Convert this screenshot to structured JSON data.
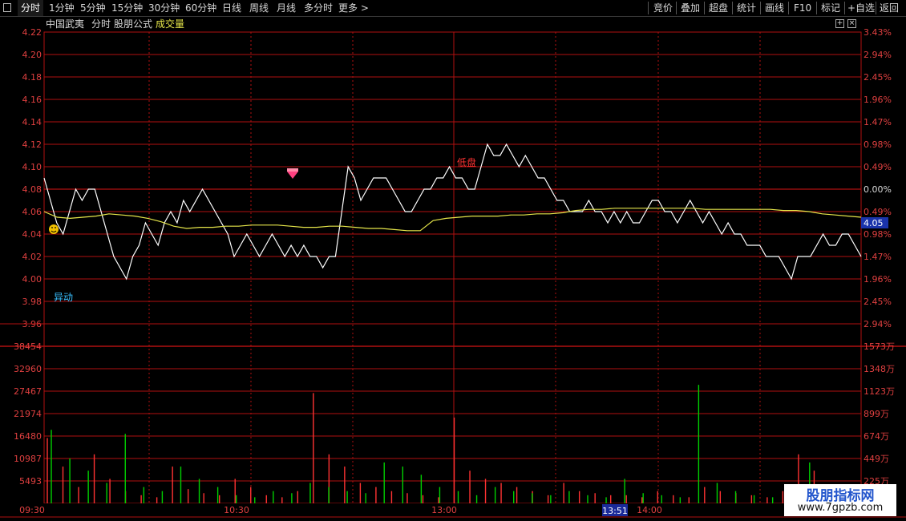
{
  "toolbar": {
    "periods": [
      "分时",
      "1分钟",
      "5分钟",
      "15分钟",
      "30分钟",
      "60分钟",
      "日线",
      "周线",
      "月线",
      "多分时"
    ],
    "more": "更多",
    "right_buttons": [
      "竞价",
      "叠加",
      "超盘",
      "统计",
      "画线",
      "F10",
      "标记",
      "+自选",
      "返回"
    ]
  },
  "subbar": {
    "stock_name": "中国武夷",
    "mode": "分时",
    "formula": "股朋公式",
    "volume_label": "成交量"
  },
  "price_axis": {
    "left_labels": [
      "4.22",
      "4.20",
      "4.18",
      "4.16",
      "4.14",
      "4.12",
      "4.10",
      "4.08",
      "4.06",
      "4.04",
      "4.02",
      "4.00",
      "3.98",
      "3.96"
    ],
    "right_labels": [
      "3.43%",
      "2.94%",
      "2.45%",
      "1.96%",
      "1.47%",
      "0.98%",
      "0.49%",
      "0.00%",
      "0.49%",
      "0.98%",
      "1.47%",
      "1.96%",
      "2.45%",
      "2.94%"
    ],
    "current_price": "4.05",
    "ylim": [
      3.96,
      4.22
    ]
  },
  "volume_axis": {
    "left_labels": [
      "38454",
      "32960",
      "27467",
      "21974",
      "16480",
      "10987",
      "5493"
    ],
    "right_labels": [
      "1573万",
      "1348万",
      "1123万",
      "899万",
      "674万",
      "449万",
      "225万"
    ]
  },
  "time_axis": {
    "labels": [
      "09:30",
      "10:30",
      "13:00",
      "14:00"
    ],
    "cursor_time": "13:51"
  },
  "annotations": {
    "yidong": "异动",
    "dipan": "低盘"
  },
  "colors": {
    "up": "#ff3232",
    "down": "#00d000",
    "grid": "#b01010",
    "price_line": "#ffffff",
    "avg_line": "#e6e64a",
    "text_left": "#e04040",
    "text_cyan": "#38c0ff"
  },
  "chart_data": {
    "type": "line",
    "price": [
      4.09,
      4.07,
      4.05,
      4.04,
      4.06,
      4.08,
      4.07,
      4.08,
      4.08,
      4.06,
      4.04,
      4.02,
      4.01,
      4.0,
      4.02,
      4.03,
      4.05,
      4.04,
      4.03,
      4.05,
      4.06,
      4.05,
      4.07,
      4.06,
      4.07,
      4.08,
      4.07,
      4.06,
      4.05,
      4.04,
      4.02,
      4.03,
      4.04,
      4.03,
      4.02,
      4.03,
      4.04,
      4.03,
      4.02,
      4.03,
      4.02,
      4.03,
      4.02,
      4.02,
      4.01,
      4.02,
      4.02,
      4.06,
      4.1,
      4.09,
      4.07,
      4.08,
      4.09,
      4.09,
      4.09,
      4.08,
      4.07,
      4.06,
      4.06,
      4.07,
      4.08,
      4.08,
      4.09,
      4.09,
      4.1,
      4.09,
      4.09,
      4.08,
      4.08,
      4.1,
      4.12,
      4.11,
      4.11,
      4.12,
      4.11,
      4.1,
      4.11,
      4.1,
      4.09,
      4.09,
      4.08,
      4.07,
      4.07,
      4.06,
      4.06,
      4.06,
      4.07,
      4.06,
      4.06,
      4.05,
      4.06,
      4.05,
      4.06,
      4.05,
      4.05,
      4.06,
      4.07,
      4.07,
      4.06,
      4.06,
      4.05,
      4.06,
      4.07,
      4.06,
      4.05,
      4.06,
      4.05,
      4.04,
      4.05,
      4.04,
      4.04,
      4.03,
      4.03,
      4.03,
      4.02,
      4.02,
      4.02,
      4.01,
      4.0,
      4.02,
      4.02,
      4.02,
      4.03,
      4.04,
      4.03,
      4.03,
      4.04,
      4.04,
      4.03,
      4.02
    ],
    "avg": [
      4.06,
      4.055,
      4.054,
      4.055,
      4.056,
      4.058,
      4.057,
      4.056,
      4.054,
      4.051,
      4.047,
      4.045,
      4.046,
      4.046,
      4.047,
      4.047,
      4.048,
      4.048,
      4.048,
      4.047,
      4.046,
      4.046,
      4.047,
      4.047,
      4.046,
      4.045,
      4.045,
      4.044,
      4.043,
      4.043,
      4.052,
      4.054,
      4.055,
      4.056,
      4.056,
      4.056,
      4.057,
      4.057,
      4.058,
      4.058,
      4.059,
      4.061,
      4.062,
      4.062,
      4.063,
      4.063,
      4.063,
      4.063,
      4.063,
      4.063,
      4.063,
      4.062,
      4.062,
      4.062,
      4.062,
      4.062,
      4.062,
      4.061,
      4.061,
      4.06,
      4.058,
      4.057,
      4.056,
      4.055
    ],
    "volume_up": [
      16000,
      9000,
      4000,
      12000,
      6000,
      3000,
      2000,
      1500,
      9000,
      3500,
      2500,
      2000,
      6000,
      4000,
      2000,
      1500,
      3000,
      27000,
      12000,
      9000,
      5000,
      4000,
      3000,
      2500,
      2000,
      1500,
      21000,
      8000,
      6000,
      5000,
      4000,
      3000,
      2000,
      5000,
      3000,
      2500,
      2000,
      2000,
      1500,
      3000,
      2000,
      1500,
      4000,
      3000,
      2500,
      2000,
      1500,
      3000,
      12000,
      8000,
      4000,
      2000
    ],
    "volume_down": [
      18000,
      11000,
      8000,
      5000,
      17000,
      4000,
      3000,
      9000,
      6000,
      4000,
      2000,
      1500,
      3000,
      2500,
      5000,
      4000,
      3000,
      2500,
      10000,
      9000,
      7000,
      4000,
      3000,
      2000,
      4000,
      3000,
      2500,
      2000,
      3000,
      2000,
      1500,
      6000,
      2500,
      2000,
      1500,
      29000,
      5000,
      3000,
      2000,
      1500,
      2000,
      10000,
      3000,
      2000
    ]
  }
}
